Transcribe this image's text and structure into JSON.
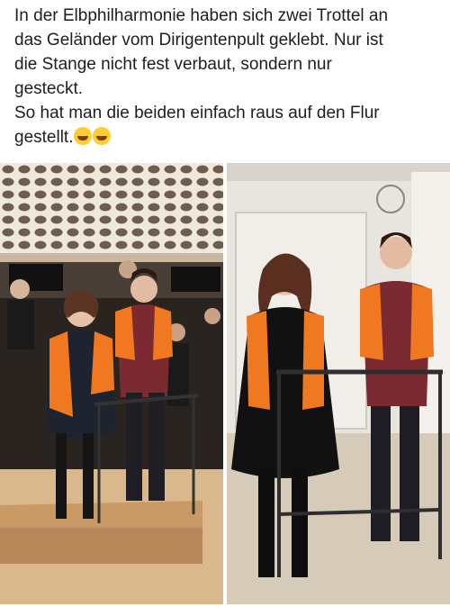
{
  "post": {
    "lines": [
      "In der Elbphilharmonie haben sich zwei Trottel an",
      "das Geländer vom Dirigentenpult geklebt. Nur ist",
      "die Stange nicht fest verbaut, sondern nur",
      "gesteckt.",
      "So hat man die beiden einfach raus auf den Flur",
      "gestellt."
    ],
    "emojis": [
      "laughing-emoji",
      "rolling-laughing-emoji"
    ]
  },
  "colors": {
    "vest": "#f07820",
    "text": "#1c1e21",
    "stage_wood": "#d2a06c",
    "wall_pattern": "#6e5d4f"
  }
}
